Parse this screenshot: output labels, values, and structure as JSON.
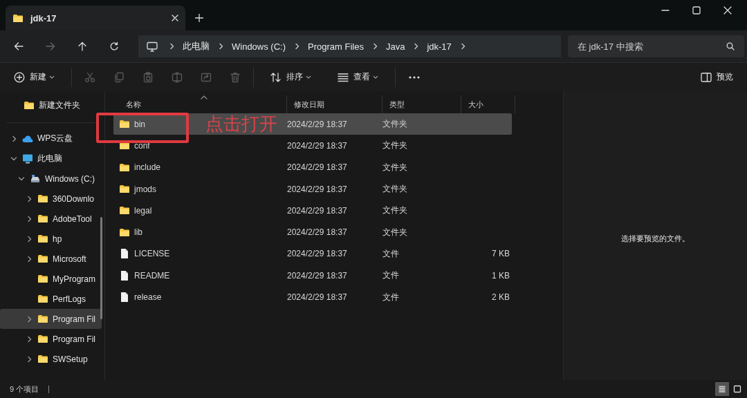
{
  "window": {
    "tab": {
      "title": "jdk-17",
      "selected": true
    }
  },
  "address_bar": {
    "crumbs": [
      "此电脑",
      "Windows (C:)",
      "Program Files",
      "Java",
      "jdk-17"
    ],
    "search": {
      "placeholder": "在 jdk-17 中搜索"
    }
  },
  "toolbar": {
    "new_label": "新建",
    "actions": [
      {
        "kind": "cut",
        "disabled": true
      },
      {
        "kind": "copy",
        "disabled": true
      },
      {
        "kind": "paste",
        "disabled": true
      },
      {
        "kind": "rename",
        "disabled": true
      },
      {
        "kind": "share",
        "disabled": true
      },
      {
        "kind": "delete",
        "disabled": true
      }
    ],
    "sort_label": "排序",
    "view_label": "查看",
    "preview_label": "预览"
  },
  "sidebar": {
    "quick_access": [
      {
        "label": "新建文件夹",
        "selected": false
      }
    ],
    "items": [
      {
        "label": "WPS云盘",
        "kind": "cloud",
        "expandable": true,
        "expanded": false,
        "selected": false
      },
      {
        "label": "此电脑",
        "kind": "pc",
        "expandable": true,
        "expanded": true,
        "selected": false,
        "children": [
          {
            "label": "Windows (C:)",
            "kind": "drive",
            "expandable": true,
            "expanded": true,
            "selected": false,
            "children": [
              {
                "label": "360Downlo",
                "kind": "folder",
                "expandable": true,
                "expanded": false,
                "selected": false
              },
              {
                "label": "AdobeTool",
                "kind": "folder",
                "expandable": true,
                "expanded": false,
                "selected": false
              },
              {
                "label": "hp",
                "kind": "folder",
                "expandable": true,
                "expanded": false,
                "selected": false
              },
              {
                "label": "Microsoft",
                "kind": "folder",
                "expandable": true,
                "expanded": false,
                "selected": false
              },
              {
                "label": "MyProgram",
                "kind": "folder",
                "expandable": false,
                "expanded": false,
                "selected": false
              },
              {
                "label": "PerfLogs",
                "kind": "folder",
                "expandable": false,
                "expanded": false,
                "selected": false
              },
              {
                "label": "Program Fil",
                "kind": "folder",
                "expandable": true,
                "expanded": false,
                "selected": true
              },
              {
                "label": "Program Fil",
                "kind": "folder",
                "expandable": true,
                "expanded": false,
                "selected": false
              },
              {
                "label": "SWSetup",
                "kind": "folder",
                "expandable": true,
                "expanded": false,
                "selected": false
              }
            ]
          }
        ]
      }
    ]
  },
  "file_list": {
    "columns": [
      "名称",
      "修改日期",
      "类型",
      "大小"
    ],
    "rows": [
      {
        "name": "bin",
        "kind": "folder",
        "date": "2024/2/29 18:37",
        "type": "文件夹",
        "selected": true
      },
      {
        "name": "conf",
        "kind": "folder",
        "date": "2024/2/29 18:37",
        "type": "文件夹",
        "selected": false
      },
      {
        "name": "include",
        "kind": "folder",
        "date": "2024/2/29 18:37",
        "type": "文件夹",
        "selected": false
      },
      {
        "name": "jmods",
        "kind": "folder",
        "date": "2024/2/29 18:37",
        "type": "文件夹",
        "selected": false
      },
      {
        "name": "legal",
        "kind": "folder",
        "date": "2024/2/29 18:37",
        "type": "文件夹",
        "selected": false
      },
      {
        "name": "lib",
        "kind": "folder",
        "date": "2024/2/29 18:37",
        "type": "文件夹",
        "selected": false
      },
      {
        "name": "LICENSE",
        "kind": "file",
        "date": "2024/2/29 18:37",
        "type": "文件",
        "size": "7 KB",
        "selected": false
      },
      {
        "name": "README",
        "kind": "file",
        "date": "2024/2/29 18:37",
        "type": "文件",
        "size": "1 KB",
        "selected": false
      },
      {
        "name": "release",
        "kind": "file",
        "date": "2024/2/29 18:37",
        "type": "文件",
        "size": "2 KB",
        "selected": false
      }
    ]
  },
  "annotation": {
    "text": "点击打开"
  },
  "preview_pane": {
    "message": "选择要预览的文件。"
  },
  "status_bar": {
    "count": "9 个项目",
    "views": [
      {
        "kind": "details",
        "selected": true
      },
      {
        "kind": "tiles",
        "selected": false
      }
    ]
  }
}
